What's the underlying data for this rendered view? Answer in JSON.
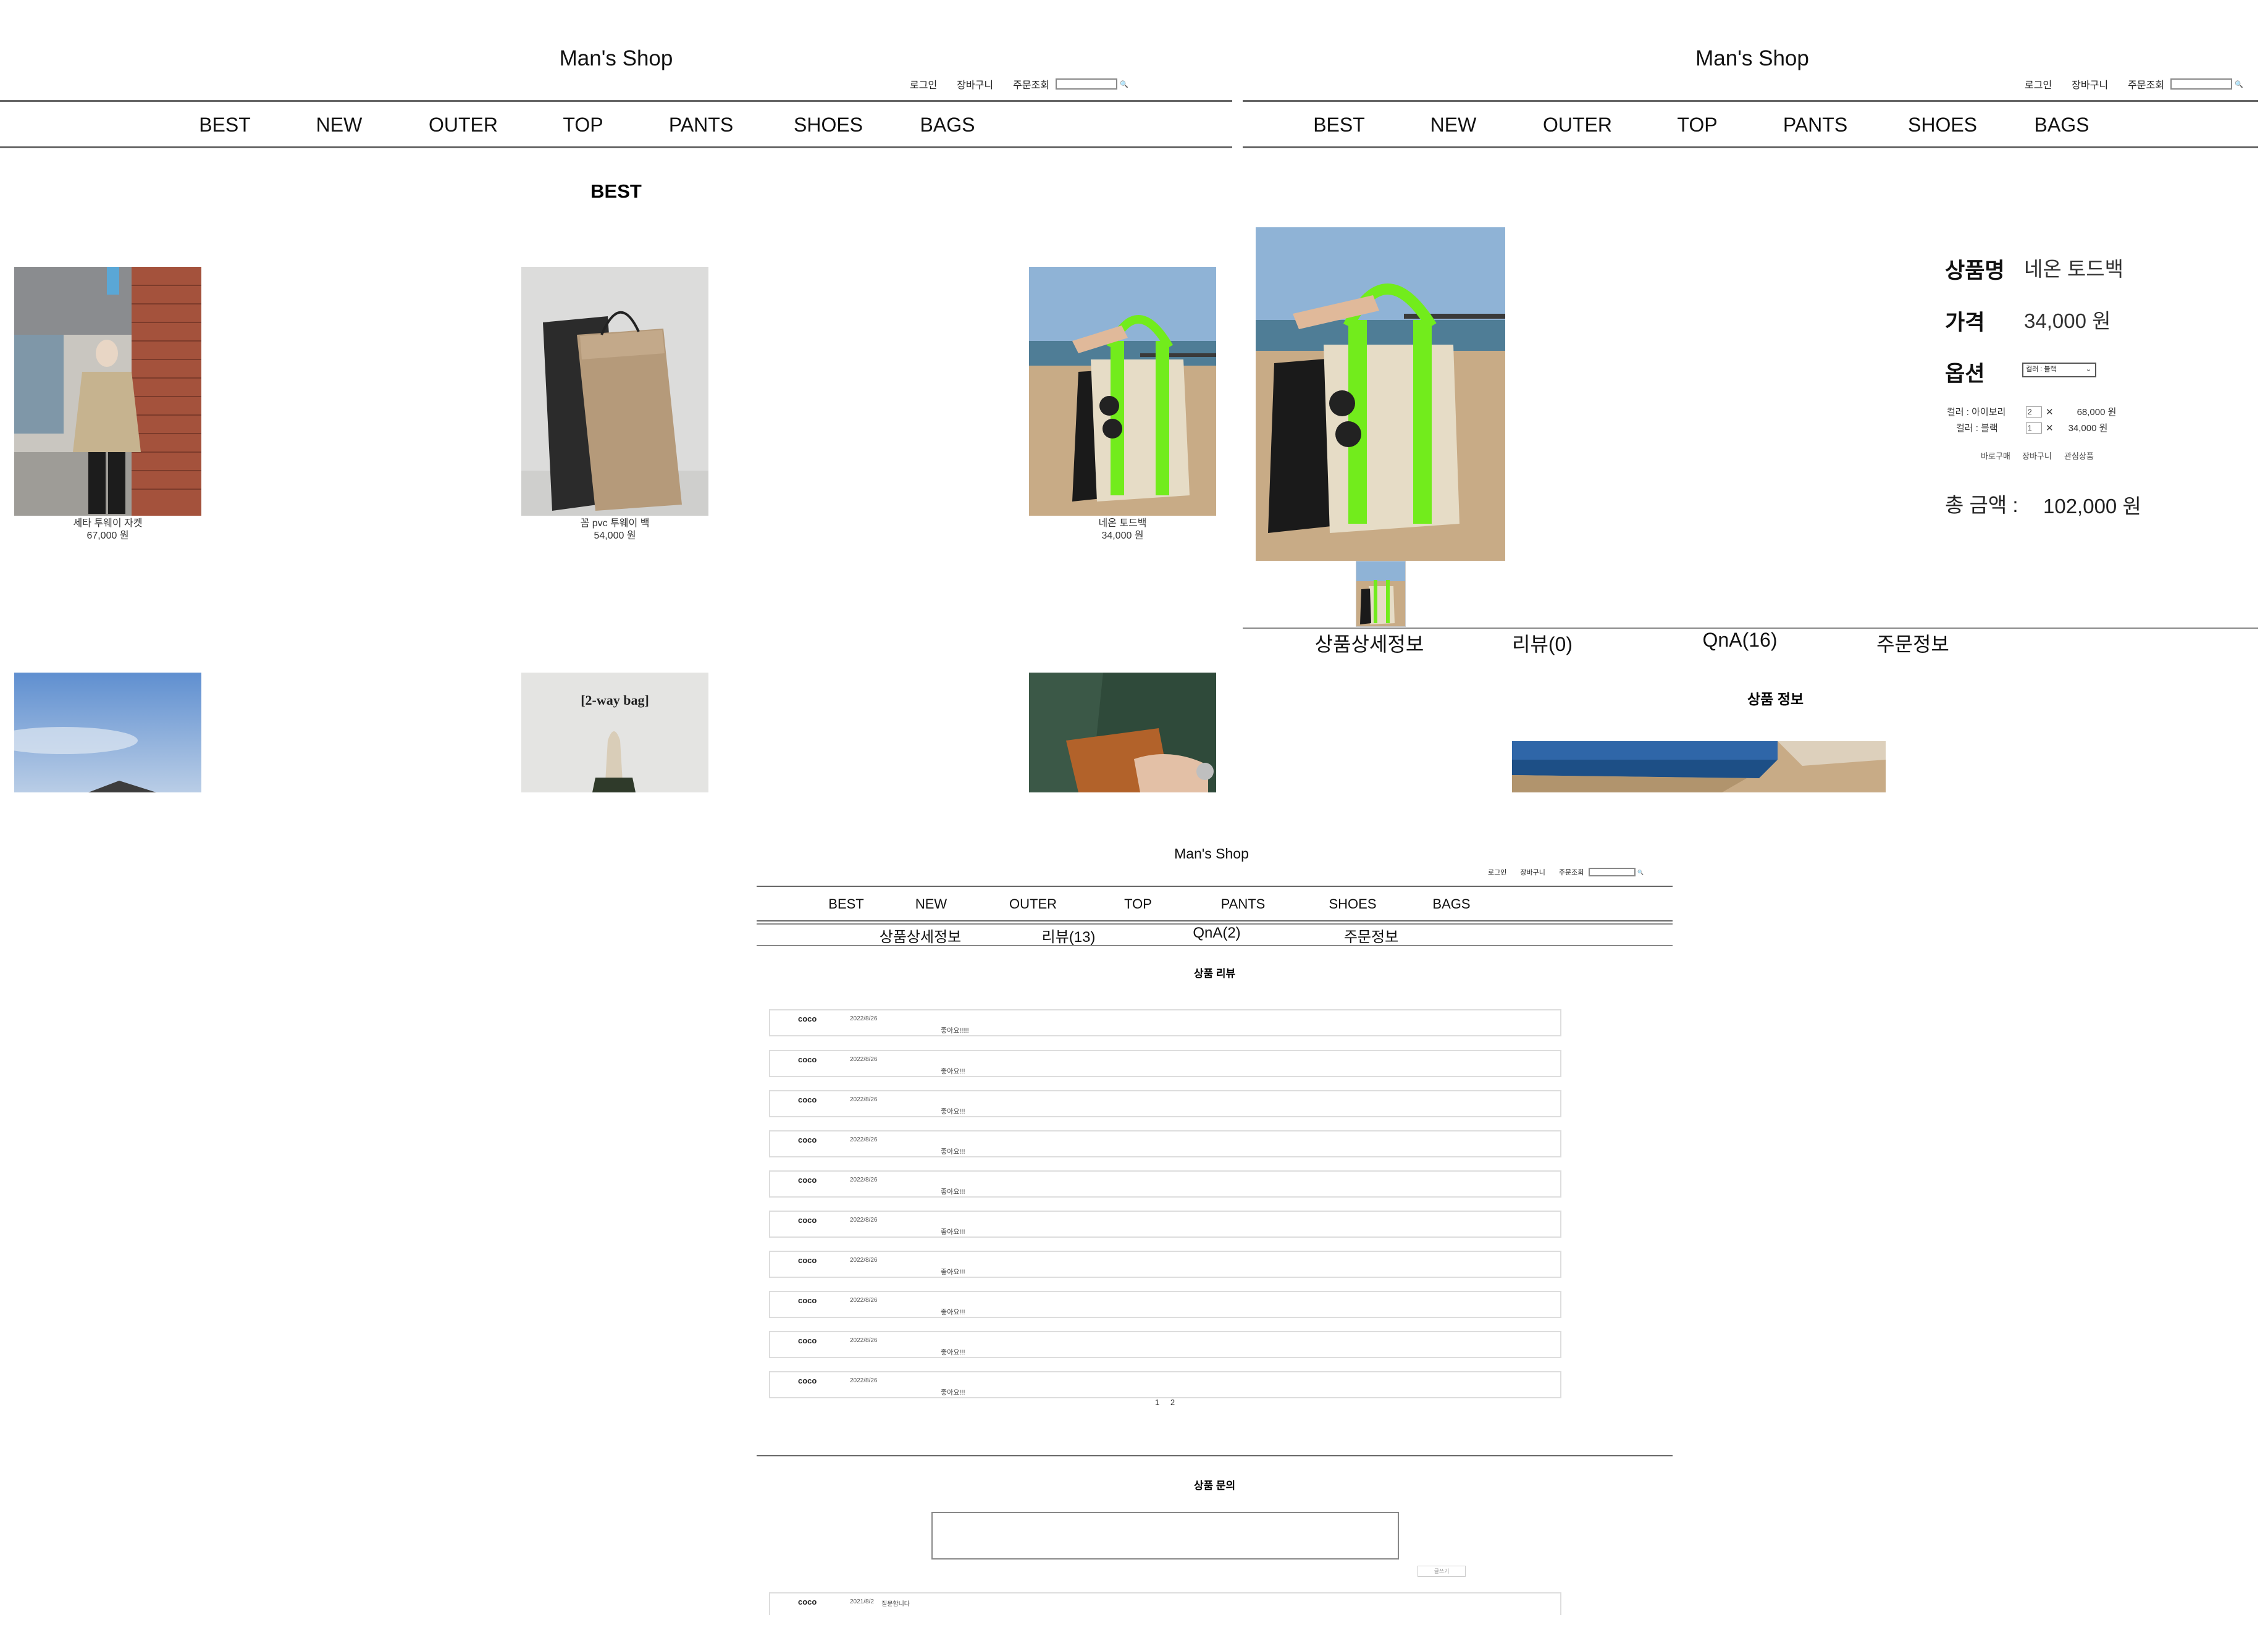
{
  "header": {
    "brand": "Man's Shop",
    "util_links": [
      "로그인",
      "장바구니",
      "주문조회"
    ],
    "search_button_glyph": "🔍"
  },
  "nav": [
    "BEST",
    "NEW",
    "OUTER",
    "TOP",
    "PANTS",
    "SHOES",
    "BAGS"
  ],
  "list_page": {
    "section_title": "BEST",
    "products": [
      {
        "name": "세타 투웨이 자켓",
        "price": "67,000 원"
      },
      {
        "name": "꼼 pvc 투웨이 백",
        "price": "54,000 원"
      },
      {
        "name": "네온 토드백",
        "price": "34,000 원"
      }
    ],
    "row2_thumb_text": "[2-way bag]"
  },
  "detail_page": {
    "labels": {
      "name": "상품명",
      "price": "가격",
      "option": "옵션",
      "total": "총 금액 :"
    },
    "product_name": "네온 토드백",
    "price": "34,000 원",
    "option_selected": "컬러 : 블랙",
    "selected_options": [
      {
        "label": "컬러 : 아이보리",
        "qty": "2",
        "price": "68,000 원"
      },
      {
        "label": "컬러 : 블랙",
        "qty": "1",
        "price": "34,000 원"
      }
    ],
    "remove_glyph": "✕",
    "buttons": [
      "바로구매",
      "장바구니",
      "관심상품"
    ],
    "total": "102,000 원",
    "tabs": [
      "상품상세정보",
      "리뷰(0)",
      "QnA(16)",
      "주문정보"
    ],
    "section_title": "상품 정보"
  },
  "review_page": {
    "tabs": [
      "상품상세정보",
      "리뷰(13)",
      "QnA(2)",
      "주문정보"
    ],
    "section_title": "상품 리뷰",
    "reviews": [
      {
        "user": "coco",
        "date": "2022/8/26",
        "text": "좋아요!!!!!"
      },
      {
        "user": "coco",
        "date": "2022/8/26",
        "text": "좋아요!!!"
      },
      {
        "user": "coco",
        "date": "2022/8/26",
        "text": "좋아요!!!"
      },
      {
        "user": "coco",
        "date": "2022/8/26",
        "text": "좋아요!!!"
      },
      {
        "user": "coco",
        "date": "2022/8/26",
        "text": "좋아요!!!"
      },
      {
        "user": "coco",
        "date": "2022/8/26",
        "text": "좋아요!!!"
      },
      {
        "user": "coco",
        "date": "2022/8/26",
        "text": "좋아요!!!"
      },
      {
        "user": "coco",
        "date": "2022/8/26",
        "text": "좋아요!!!"
      },
      {
        "user": "coco",
        "date": "2022/8/26",
        "text": "좋아요!!!"
      },
      {
        "user": "coco",
        "date": "2022/8/26",
        "text": "좋아요!!!"
      }
    ],
    "pages": [
      "1",
      "2"
    ],
    "qna_title": "상품 문의",
    "qna_submit": "글쓰기",
    "qna_row": {
      "user": "coco",
      "date": "2021/8/2",
      "text": "질문합니다"
    }
  }
}
